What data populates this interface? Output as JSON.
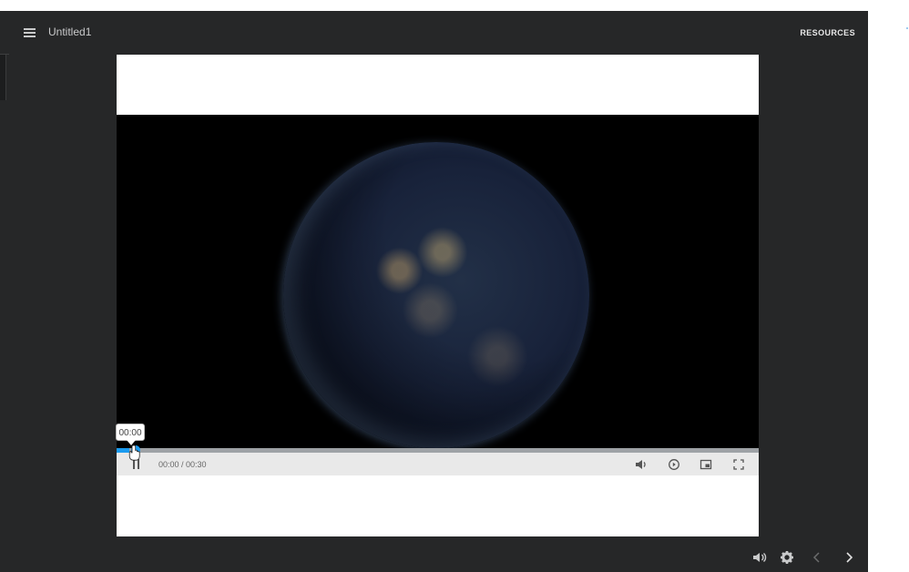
{
  "header": {
    "title": "Untitled1",
    "resources_label": "RESOURCES"
  },
  "video": {
    "tooltip_time": "00:00",
    "time_display": "00:00 / 00:30",
    "progress_fraction": 0.02
  },
  "icons": {
    "menu": "hamburger-icon",
    "pause": "pause-icon",
    "volume": "volume-icon",
    "playback_speed": "playback-icon",
    "picture_in_picture": "pip-icon",
    "fullscreen": "fullscreen-icon",
    "player_volume": "volume-icon",
    "settings": "gear-icon",
    "previous": "chevron-left-icon",
    "next": "chevron-right-icon"
  },
  "colors": {
    "frame": "#262728",
    "progress": "#1a9bf0"
  }
}
